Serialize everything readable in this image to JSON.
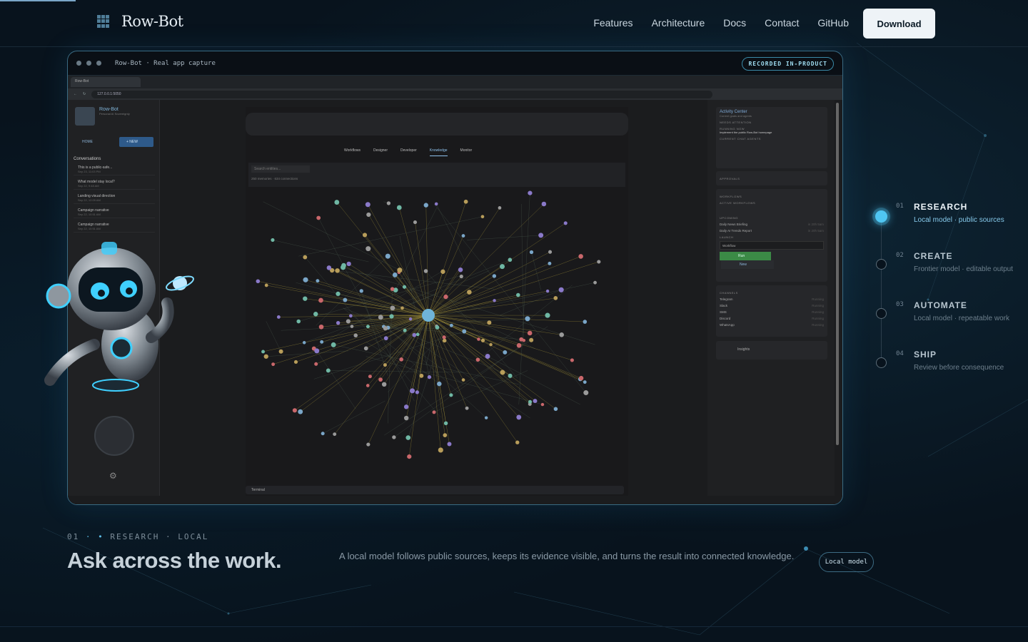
{
  "brand": {
    "name": "Row-Bot"
  },
  "nav": {
    "items": [
      "Features",
      "Architecture",
      "Docs",
      "Contact",
      "GitHub"
    ],
    "download": "Download"
  },
  "capture": {
    "title": "Row-Bot · Real app capture",
    "badge": "RECORDED IN-PRODUCT",
    "browser_tab": "Row-Bot",
    "url": "127.0.0.1:5050",
    "app": {
      "brand": "Row-Bot",
      "brand_sub": "Personal AI Sovereignty",
      "home": "HOME",
      "new": "+ NEW",
      "conversations_title": "Conversations",
      "conversations": [
        {
          "title": "This is a public-safe...",
          "time": "Sep 23, 11:03 PM"
        },
        {
          "title": "What model stay local?",
          "time": "Sep 22, 9:48 AM"
        },
        {
          "title": "Landing visual direction",
          "time": "Sep 22, 12:09 AM"
        },
        {
          "title": "Campaign narrative",
          "time": "Sep 22, 10:51 AM"
        },
        {
          "title": "Campaign narrative",
          "time": "Sep 22, 10:51 AM"
        }
      ],
      "tabs": [
        "Workflows",
        "Designer",
        "Developer",
        "Knowledge",
        "Monitor"
      ],
      "active_tab": "Knowledge",
      "search_placeholder": "Search entities...",
      "stats": "250 memories · 634 connections",
      "terminal": "Terminal",
      "activity": {
        "title": "Activity Center",
        "sub": "Current goals and agents",
        "needs_attention": "NEEDS ATTENTION",
        "running_now": "RUNNING NOW",
        "running_item": "Implement the public Row-Bot homepage",
        "current_agents": "CURRENT CHAT AGENTS",
        "approvals": "APPROVALS",
        "workflows": "WORKFLOWS",
        "active_workflows": "ACTIVE WORKFLOWS",
        "upcoming": "UPCOMING",
        "upcoming_items": [
          {
            "name": "Daily News Briefing",
            "eta": "in 20h 5am"
          },
          {
            "name": "Daily AI Trends Report",
            "eta": "in 20h 5am"
          }
        ],
        "launch": "LAUNCH",
        "launch_select": "Workflow",
        "run": "Run",
        "new": "New",
        "channels_title": "CHANNELS",
        "channels": [
          {
            "name": "Telegram",
            "status": "Running"
          },
          {
            "name": "Slack",
            "status": "Running"
          },
          {
            "name": "SMS",
            "status": "Running"
          },
          {
            "name": "Discord",
            "status": "Running"
          },
          {
            "name": "WhatsApp",
            "status": "Running"
          }
        ],
        "insights": "Insights"
      }
    }
  },
  "steps": [
    {
      "num": "01",
      "title": "RESEARCH",
      "desc": "Local model · public sources",
      "active": true
    },
    {
      "num": "02",
      "title": "CREATE",
      "desc": "Frontier model · editable output",
      "active": false
    },
    {
      "num": "03",
      "title": "AUTOMATE",
      "desc": "Local model · repeatable work",
      "active": false
    },
    {
      "num": "04",
      "title": "SHIP",
      "desc": "Review before consequence",
      "active": false
    }
  ],
  "section": {
    "eyebrow_num": "01",
    "eyebrow_text": "RESEARCH · LOCAL",
    "headline": "Ask across the work.",
    "description": "A local model follows public sources, keeps its evidence visible, and turns the result into connected knowledge.",
    "chip": "Local model"
  },
  "colors": {
    "accent": "#4fc6f2",
    "background": "#08131d",
    "button": "#eef3f7"
  }
}
